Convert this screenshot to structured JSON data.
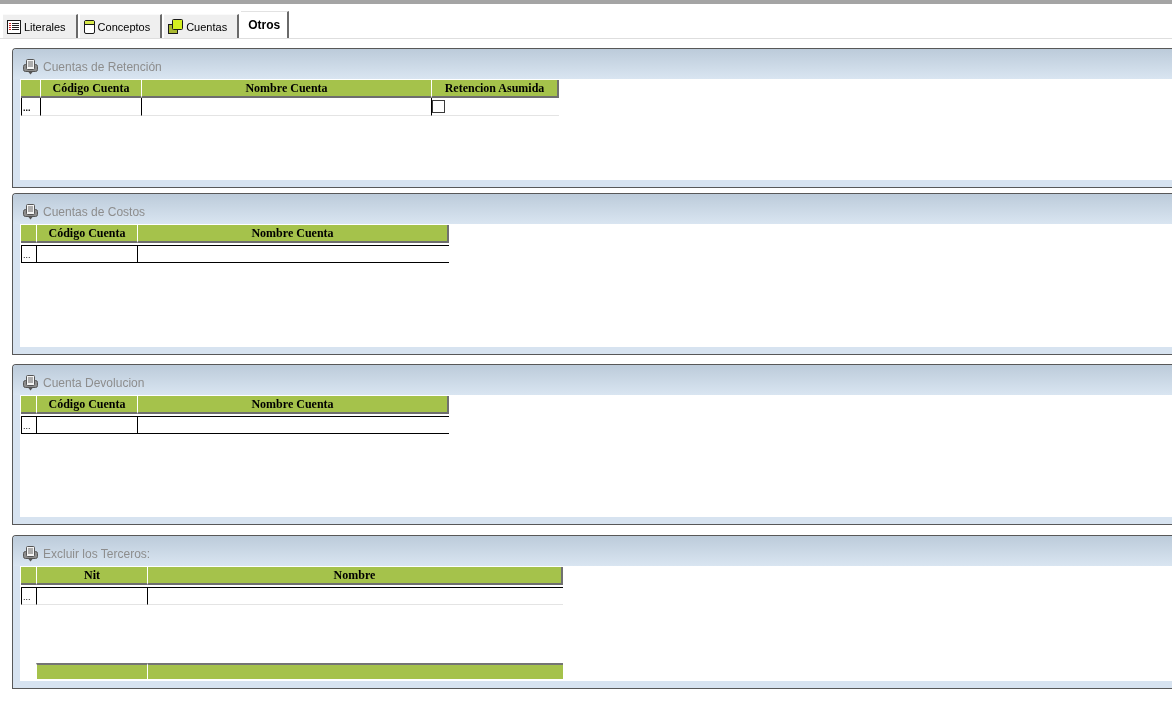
{
  "tabs": [
    {
      "label": "Literales",
      "selected": false
    },
    {
      "label": "Conceptos",
      "selected": false
    },
    {
      "label": "Cuentas",
      "selected": false
    },
    {
      "label": "Otros",
      "selected": true
    }
  ],
  "panels": [
    {
      "title": "Cuentas de Retención",
      "grid": {
        "columns": [
          {
            "label": "Código Cuenta",
            "kind": "text"
          },
          {
            "label": "Nombre Cuenta",
            "kind": "text"
          },
          {
            "label": "Retencion Asumida",
            "kind": "checkbox"
          }
        ],
        "rows": [
          {
            "indicator": "...",
            "checked": false
          }
        ]
      }
    },
    {
      "title": "Cuentas de Costos",
      "grid": {
        "columns": [
          {
            "label": "Código Cuenta",
            "kind": "text"
          },
          {
            "label": "Nombre Cuenta",
            "kind": "text"
          }
        ],
        "rows": [
          {
            "indicator": "..."
          }
        ]
      }
    },
    {
      "title": "Cuenta Devolucion",
      "grid": {
        "columns": [
          {
            "label": "Código Cuenta",
            "kind": "text"
          },
          {
            "label": "Nombre Cuenta",
            "kind": "text"
          }
        ],
        "rows": [
          {
            "indicator": "..."
          }
        ]
      }
    },
    {
      "title": "Excluir los Terceros:",
      "grid": {
        "columns": [
          {
            "label": "Nit",
            "kind": "text"
          },
          {
            "label": "Nombre",
            "kind": "text"
          }
        ],
        "rows": [
          {
            "indicator": "..."
          }
        ],
        "footer_row": true
      }
    }
  ]
}
